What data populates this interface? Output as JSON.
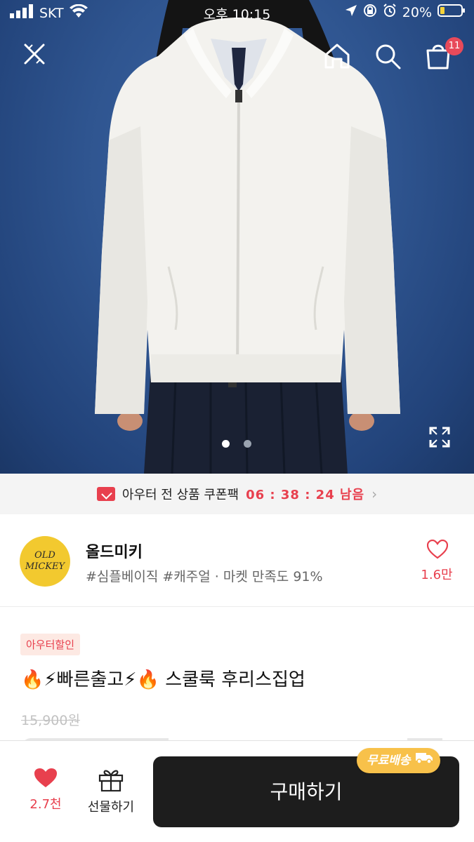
{
  "status_bar": {
    "carrier": "SKT",
    "time": "오후 10:15",
    "battery": "20%"
  },
  "top_nav": {
    "cart_count": "11"
  },
  "gallery": {
    "current_page": 1,
    "total_pages": 2
  },
  "coupon_banner": {
    "text": "아우터 전 상품 쿠폰팩",
    "timer": "06 : 38 : 24 남음"
  },
  "store": {
    "logo_text_line1": "OLD",
    "logo_text_line2": "MICKEY",
    "name": "올드미키",
    "tags": "#심플베이직 #캐주얼 · 마켓 만족도 91%",
    "likes": "1.6만"
  },
  "product": {
    "badge": "아우터할인",
    "title": "🔥⚡빠른출고⚡🔥 스쿨룩 후리스집업",
    "original_price": "15,900원"
  },
  "bottom_bar": {
    "like_count": "2.7천",
    "gift_label": "선물하기",
    "buy_label": "구매하기",
    "shipping_tag": "무료배송"
  },
  "colors": {
    "accent_red": "#e8404e",
    "buy_button": "#1d1d1d",
    "shipping_tag": "#f8c14a",
    "hero_background": "#2f5590"
  }
}
